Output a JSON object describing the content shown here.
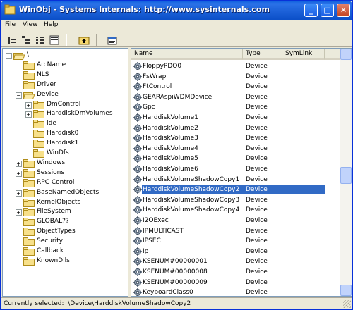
{
  "window": {
    "title": "WinObj - Systems Internals: http://www.sysinternals.com",
    "minimize": "_",
    "maximize": "□",
    "close": "✕"
  },
  "menu": [
    "File",
    "View",
    "Help"
  ],
  "toolbar": {
    "icons": [
      "open-icon",
      "tree-view-icon",
      "list-view-icon",
      "details-view-icon",
      "up-folder-icon",
      "properties-icon"
    ]
  },
  "tree": {
    "items": [
      {
        "label": "\\",
        "level": 0,
        "expander": "−"
      },
      {
        "label": "ArcName",
        "level": 1,
        "expander": ""
      },
      {
        "label": "NLS",
        "level": 1,
        "expander": ""
      },
      {
        "label": "Driver",
        "level": 1,
        "expander": ""
      },
      {
        "label": "Device",
        "level": 1,
        "expander": "−"
      },
      {
        "label": "DmControl",
        "level": 2,
        "expander": "+"
      },
      {
        "label": "HarddiskDmVolumes",
        "level": 2,
        "expander": "+"
      },
      {
        "label": "Ide",
        "level": 2,
        "expander": ""
      },
      {
        "label": "Harddisk0",
        "level": 2,
        "expander": ""
      },
      {
        "label": "Harddisk1",
        "level": 2,
        "expander": ""
      },
      {
        "label": "WinDfs",
        "level": 2,
        "expander": ""
      },
      {
        "label": "Windows",
        "level": 1,
        "expander": "+"
      },
      {
        "label": "Sessions",
        "level": 1,
        "expander": "+"
      },
      {
        "label": "RPC Control",
        "level": 1,
        "expander": ""
      },
      {
        "label": "BaseNamedObjects",
        "level": 1,
        "expander": "+"
      },
      {
        "label": "KernelObjects",
        "level": 1,
        "expander": ""
      },
      {
        "label": "FileSystem",
        "level": 1,
        "expander": "+"
      },
      {
        "label": "GLOBAL??",
        "level": 1,
        "expander": ""
      },
      {
        "label": "ObjectTypes",
        "level": 1,
        "expander": ""
      },
      {
        "label": "Security",
        "level": 1,
        "expander": ""
      },
      {
        "label": "Callback",
        "level": 1,
        "expander": ""
      },
      {
        "label": "KnownDlls",
        "level": 1,
        "expander": ""
      }
    ]
  },
  "list": {
    "columns": [
      "Name",
      "Type",
      "SymLink"
    ],
    "rows": [
      {
        "name": "FloppyPDO0",
        "type": "Device"
      },
      {
        "name": "FsWrap",
        "type": "Device"
      },
      {
        "name": "FtControl",
        "type": "Device"
      },
      {
        "name": "GEARAspiWDMDevice",
        "type": "Device"
      },
      {
        "name": "Gpc",
        "type": "Device"
      },
      {
        "name": "HarddiskVolume1",
        "type": "Device"
      },
      {
        "name": "HarddiskVolume2",
        "type": "Device"
      },
      {
        "name": "HarddiskVolume3",
        "type": "Device"
      },
      {
        "name": "HarddiskVolume4",
        "type": "Device"
      },
      {
        "name": "HarddiskVolume5",
        "type": "Device"
      },
      {
        "name": "HarddiskVolume6",
        "type": "Device"
      },
      {
        "name": "HarddiskVolumeShadowCopy1",
        "type": "Device"
      },
      {
        "name": "HarddiskVolumeShadowCopy2",
        "type": "Device",
        "selected": true
      },
      {
        "name": "HarddiskVolumeShadowCopy3",
        "type": "Device"
      },
      {
        "name": "HarddiskVolumeShadowCopy4",
        "type": "Device"
      },
      {
        "name": "I2OExec",
        "type": "Device"
      },
      {
        "name": "IPMULTICAST",
        "type": "Device"
      },
      {
        "name": "IPSEC",
        "type": "Device"
      },
      {
        "name": "Ip",
        "type": "Device"
      },
      {
        "name": "KSENUM#00000001",
        "type": "Device"
      },
      {
        "name": "KSENUM#00000008",
        "type": "Device"
      },
      {
        "name": "KSENUM#00000009",
        "type": "Device"
      },
      {
        "name": "KeyboardClass0",
        "type": "Device"
      }
    ]
  },
  "status": {
    "label": "Currently selected:",
    "value": "\\Device\\HarddiskVolumeShadowCopy2"
  }
}
